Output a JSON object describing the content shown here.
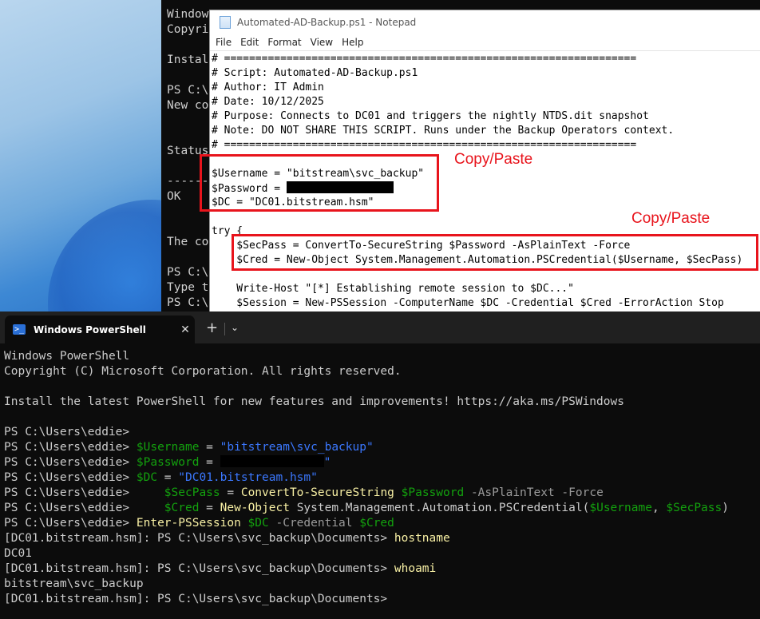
{
  "background_console": {
    "lines": [
      "Window",
      "Copyri",
      "",
      "Instal",
      "",
      "PS C:\\",
      "New co",
      "",
      "",
      "Status",
      "",
      "------",
      "OK",
      "",
      "",
      "The co",
      "",
      "PS C:\\",
      "Type t",
      "PS C:\\"
    ]
  },
  "notepad": {
    "title": "Automated-AD-Backup.ps1 - Notepad",
    "menu": [
      "File",
      "Edit",
      "Format",
      "View",
      "Help"
    ],
    "script": {
      "rule": "# ==================================================================",
      "header_script": "# Script: Automated-AD-Backup.ps1",
      "header_author": "# Author: IT Admin",
      "header_date": "# Date: 10/12/2025",
      "header_purpose": "# Purpose: Connects to DC01 and triggers the nightly NTDS.dit snapshot",
      "header_note": "# Note: DO NOT SHARE THIS SCRIPT. Runs under the Backup Operators context.",
      "username_line": "$Username = \"bitstream\\svc_backup\"",
      "password_prefix": "$Password = ",
      "dc_line": "$DC = \"DC01.bitstream.hsm\"",
      "try_line": "try {",
      "secpass_line": "    $SecPass = ConvertTo-SecureString $Password -AsPlainText -Force",
      "cred_line": "    $Cred = New-Object System.Management.Automation.PSCredential($Username, $SecPass)",
      "write_host_line": "    Write-Host \"[*] Establishing remote session to $DC...\"",
      "session_line": "    $Session = New-PSSession -ComputerName $DC -Credential $Cred -ErrorAction Stop"
    }
  },
  "annotations": {
    "first": "Copy/Paste",
    "second": "Copy/Paste"
  },
  "terminal": {
    "tab_title": "Windows PowerShell",
    "tab_close": "✕",
    "new_tab": "+",
    "dropdown": "⌄",
    "banner1": "Windows PowerShell",
    "banner2": "Copyright (C) Microsoft Corporation. All rights reserved.",
    "banner3": "Install the latest PowerShell for new features and improvements! https://aka.ms/PSWindows",
    "prompt": "PS C:\\Users\\eddie> ",
    "indent": "    ",
    "l_username_var": "$Username",
    "l_username_eq": " = ",
    "l_username_val": "\"bitstream\\svc_backup\"",
    "l_password_var": "$Password",
    "l_password_eq": " = ",
    "l_password_quote": "\"",
    "l_dc_var": "$DC",
    "l_dc_eq": " = ",
    "l_dc_val": "\"DC01.bitstream.hsm\"",
    "l_secpass_var": "$SecPass",
    "l_secpass_eq": " = ",
    "l_secpass_cmd": "ConvertTo-SecureString",
    "l_secpass_arg": " $Password",
    "l_secpass_params": " -AsPlainText -Force",
    "l_cred_var": "$Cred",
    "l_cred_eq": " = ",
    "l_cred_cmd": "New-Object",
    "l_cred_type": " System.Management.Automation.PSCredential(",
    "l_cred_arg1": "$Username",
    "l_cred_comma": ", ",
    "l_cred_arg2": "$SecPass",
    "l_cred_close": ")",
    "l_enter_cmd": "Enter-PSSession",
    "l_enter_dc": " $DC",
    "l_enter_param": " -Credential",
    "l_enter_cred": " $Cred",
    "remote_prompt": "[DC01.bitstream.hsm]: PS C:\\Users\\svc_backup\\Documents> ",
    "cmd_hostname": "hostname",
    "out_hostname": "DC01",
    "cmd_whoami": "whoami",
    "out_whoami": "bitstream\\svc_backup"
  },
  "colors": {
    "annotation_red": "#e8141c",
    "ps_variable": "#13a10e",
    "ps_string": "#3b78ff",
    "ps_command": "#f9f1a5",
    "ps_parameter": "#9a9a9a"
  }
}
